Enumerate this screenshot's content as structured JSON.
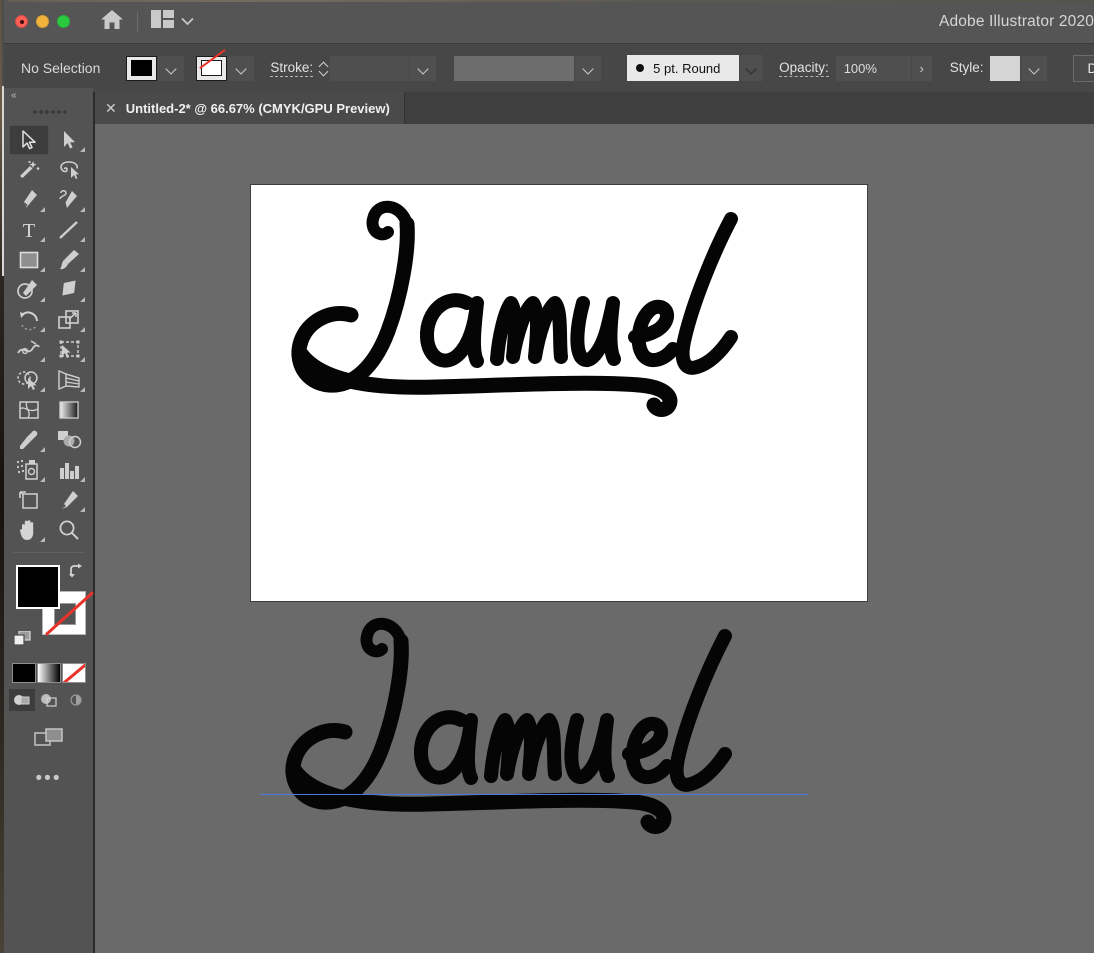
{
  "window": {
    "app_title": "Adobe Illustrator 2020",
    "traffic_lights": [
      "close-red",
      "minimize-yellow",
      "maximize-green"
    ],
    "home_icon": "home-icon",
    "arrange_documents_icon": "arrange-documents-icon",
    "arrange_caret_icon": "chevron-down-icon"
  },
  "control_bar": {
    "grip": "panel-grip",
    "selection_status": "No Selection",
    "fill_swatch": {
      "name": "fill-color-swatch",
      "color": "#000000"
    },
    "fill_caret": "chevron-down-icon",
    "stroke_swatch": {
      "name": "stroke-color-swatch",
      "color": "none"
    },
    "stroke_caret": "chevron-down-icon",
    "stroke_label": "Stroke:",
    "stroke_weight_value": "",
    "stroke_weight_caret": "chevron-down-icon",
    "variable_width_profile": "",
    "width_profile_caret": "chevron-down-icon",
    "brush_definition": "5 pt. Round",
    "brush_caret": "chevron-down-icon",
    "opacity_label": "Opacity:",
    "opacity_value": "100%",
    "opacity_arrow": "›",
    "style_label": "Style:",
    "style_swatch_color": "#d5d5d5",
    "style_caret": "chevron-down-icon",
    "document_setup_label": "Document Setup"
  },
  "tab_bar": {
    "tabs": [
      {
        "close_icon": "close-icon",
        "title": "Untitled-2* @ 66.67% (CMYK/GPU Preview)",
        "active": true
      }
    ]
  },
  "tools_panel": {
    "collapse_icon": "«",
    "grip": "panel-grip",
    "tools": [
      {
        "name": "selection-tool",
        "active": true,
        "has_flyout": false
      },
      {
        "name": "direct-selection-tool",
        "active": false,
        "has_flyout": true
      },
      {
        "name": "magic-wand-tool",
        "active": false,
        "has_flyout": false
      },
      {
        "name": "lasso-tool",
        "active": false,
        "has_flyout": false
      },
      {
        "name": "pen-tool",
        "active": false,
        "has_flyout": true
      },
      {
        "name": "curvature-tool",
        "active": false,
        "has_flyout": false
      },
      {
        "name": "type-tool",
        "active": false,
        "has_flyout": true
      },
      {
        "name": "line-segment-tool",
        "active": false,
        "has_flyout": true
      },
      {
        "name": "rectangle-tool",
        "active": false,
        "has_flyout": true
      },
      {
        "name": "paintbrush-tool",
        "active": false,
        "has_flyout": true
      },
      {
        "name": "shaper-tool",
        "active": false,
        "has_flyout": true
      },
      {
        "name": "eraser-tool",
        "active": false,
        "has_flyout": true
      },
      {
        "name": "rotate-tool",
        "active": false,
        "has_flyout": true
      },
      {
        "name": "scale-tool",
        "active": false,
        "has_flyout": true
      },
      {
        "name": "width-tool",
        "active": false,
        "has_flyout": true
      },
      {
        "name": "free-transform-tool",
        "active": false,
        "has_flyout": true
      },
      {
        "name": "shape-builder-tool",
        "active": false,
        "has_flyout": true
      },
      {
        "name": "perspective-grid-tool",
        "active": false,
        "has_flyout": true
      },
      {
        "name": "mesh-tool",
        "active": false,
        "has_flyout": false
      },
      {
        "name": "gradient-tool",
        "active": false,
        "has_flyout": false
      },
      {
        "name": "eyedropper-tool",
        "active": false,
        "has_flyout": true
      },
      {
        "name": "blend-tool",
        "active": false,
        "has_flyout": false
      },
      {
        "name": "symbol-sprayer-tool",
        "active": false,
        "has_flyout": true
      },
      {
        "name": "column-graph-tool",
        "active": false,
        "has_flyout": true
      },
      {
        "name": "artboard-tool",
        "active": false,
        "has_flyout": false
      },
      {
        "name": "slice-tool",
        "active": false,
        "has_flyout": true
      },
      {
        "name": "hand-tool",
        "active": false,
        "has_flyout": true
      },
      {
        "name": "zoom-tool",
        "active": false,
        "has_flyout": false
      }
    ],
    "fill_color": "#000000",
    "stroke_color": "none",
    "swap_icon": "swap-fill-stroke-icon",
    "default_icon": "default-fill-stroke-icon",
    "color_modes": [
      {
        "name": "color-mode-button",
        "style": "solid-black"
      },
      {
        "name": "gradient-mode-button",
        "style": "gradient"
      },
      {
        "name": "none-mode-button",
        "style": "none"
      }
    ],
    "drawing_modes": [
      {
        "name": "draw-normal-mode",
        "selected": true
      },
      {
        "name": "draw-behind-mode",
        "selected": false
      },
      {
        "name": "draw-inside-mode",
        "selected": false
      }
    ],
    "screen_mode_icon": "change-screen-mode-icon",
    "more_tools": "•••"
  },
  "canvas": {
    "background_color": "#6a6a6a",
    "artboard_color": "#ffffff",
    "artwork_text": "Samuel",
    "artwork_style": "hand-lettered-script",
    "guide_color": "#4b79dd",
    "objects": [
      {
        "name": "lettering-artwork-on-artboard",
        "text": "Samuel"
      },
      {
        "name": "lettering-artwork-below-artboard",
        "text": "Samuel"
      },
      {
        "name": "guide-line",
        "color": "#4b79dd"
      }
    ]
  }
}
